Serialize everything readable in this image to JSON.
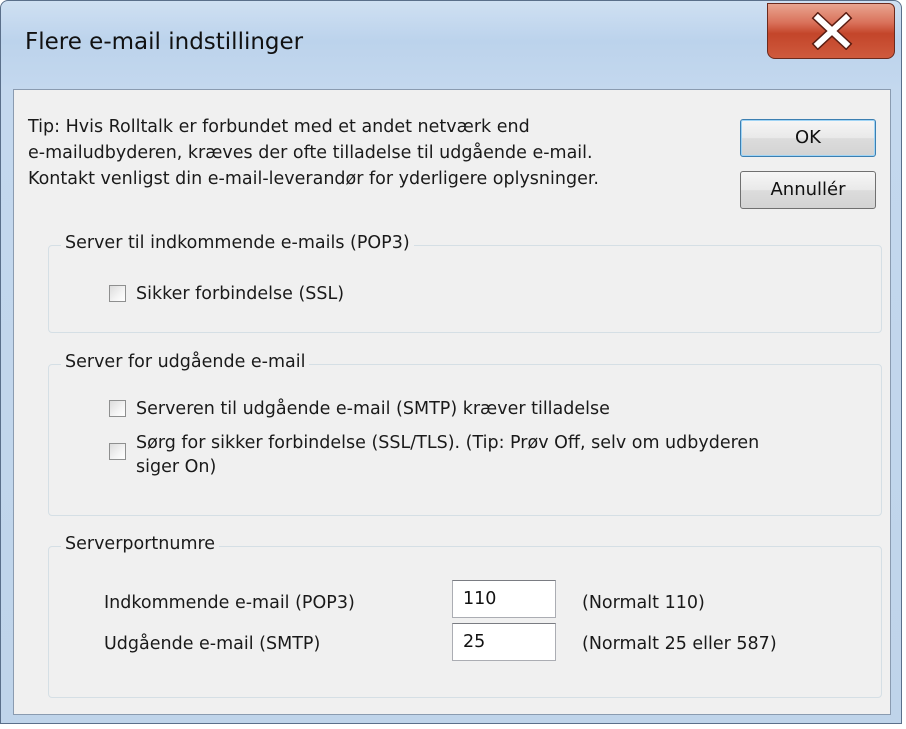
{
  "window": {
    "title": "Flere e-mail indstillinger"
  },
  "tip": {
    "lines": [
      "Tip: Hvis Rolltalk er forbundet med et andet netværk end",
      "e-mailudbyderen, kræves der ofte tilladelse til udgående e-mail.",
      "Kontakt venligst din e-mail-leverandør for yderligere oplysninger."
    ]
  },
  "buttons": {
    "ok": "OK",
    "cancel": "Annullér"
  },
  "incoming": {
    "legend": "Server til indkommende e-mails (POP3)",
    "ssl_label": "Sikker forbindelse (SSL)",
    "ssl_checked": false
  },
  "outgoing": {
    "legend": "Server for udgående e-mail",
    "auth_label": "Serveren til udgående e-mail (SMTP) kræver tilladelse",
    "auth_checked": false,
    "tls_label_line1": "Sørg for sikker forbindelse (SSL/TLS). (Tip: Prøv Off, selv om udbyderen",
    "tls_label_line2": "siger On)",
    "tls_checked": false
  },
  "ports": {
    "legend": "Serverportnumre",
    "incoming_label": "Indkommende e-mail (POP3)",
    "incoming_value": "110",
    "incoming_hint": "(Normalt 110)",
    "outgoing_label": "Udgående e-mail (SMTP)",
    "outgoing_value": "25",
    "outgoing_hint": "(Normalt 25 eller 587)"
  }
}
